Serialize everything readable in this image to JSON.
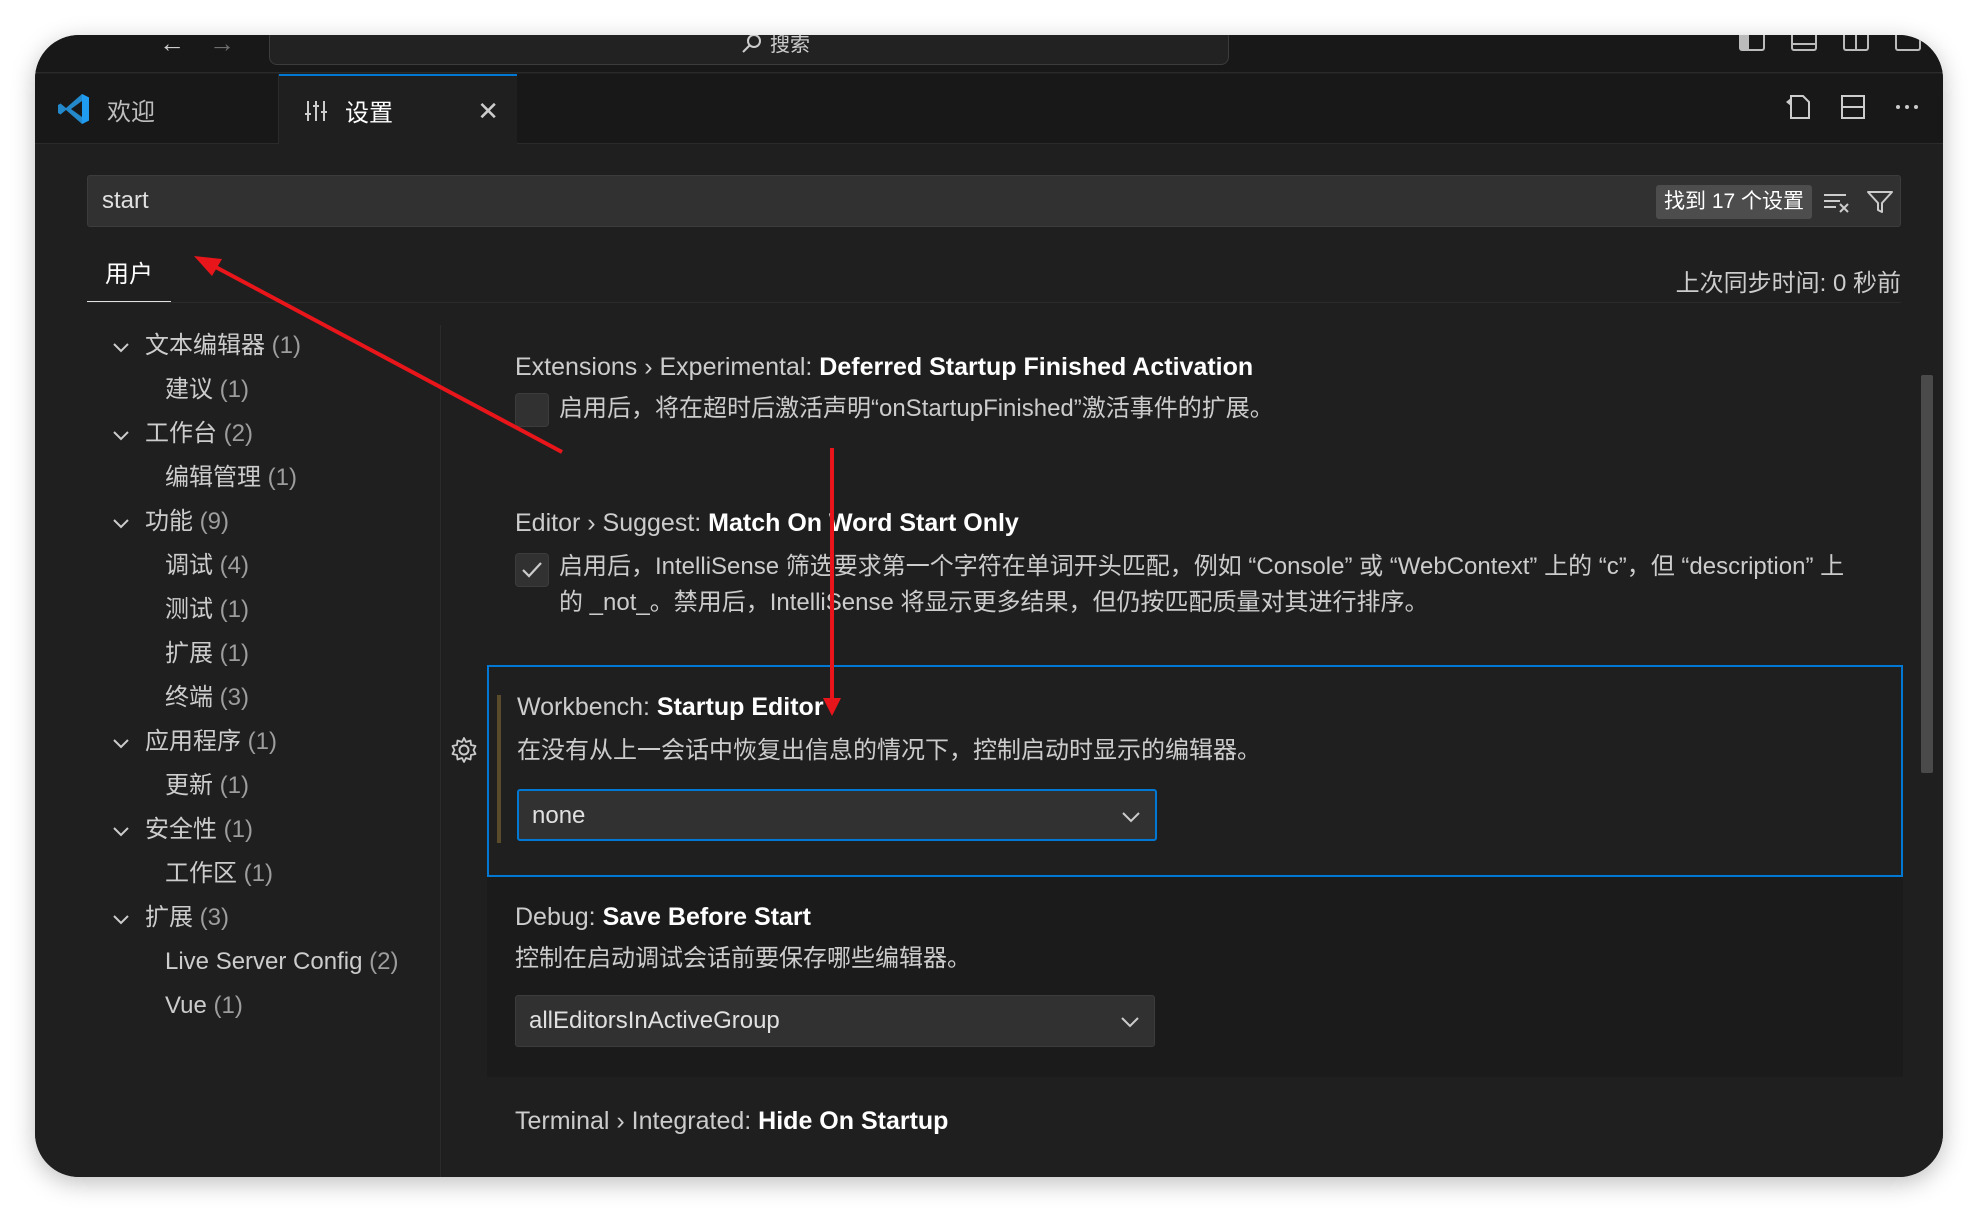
{
  "titlebar": {
    "command_center_placeholder": "搜索"
  },
  "tabs": [
    {
      "label": "欢迎"
    },
    {
      "label": "设置"
    }
  ],
  "search": {
    "value": "start",
    "result_count": "找到 17 个设置"
  },
  "scope": {
    "user_tab": "用户",
    "sync_status": "上次同步时间: 0 秒前"
  },
  "toc": [
    {
      "label": "文本编辑器",
      "count": "(1)",
      "level": 0
    },
    {
      "label": "建议",
      "count": "(1)",
      "level": 1
    },
    {
      "label": "工作台",
      "count": "(2)",
      "level": 0
    },
    {
      "label": "编辑管理",
      "count": "(1)",
      "level": 1
    },
    {
      "label": "功能",
      "count": "(9)",
      "level": 0
    },
    {
      "label": "调试",
      "count": "(4)",
      "level": 1
    },
    {
      "label": "测试",
      "count": "(1)",
      "level": 1
    },
    {
      "label": "扩展",
      "count": "(1)",
      "level": 1
    },
    {
      "label": "终端",
      "count": "(3)",
      "level": 1
    },
    {
      "label": "应用程序",
      "count": "(1)",
      "level": 0
    },
    {
      "label": "更新",
      "count": "(1)",
      "level": 1
    },
    {
      "label": "安全性",
      "count": "(1)",
      "level": 0
    },
    {
      "label": "工作区",
      "count": "(1)",
      "level": 1
    },
    {
      "label": "扩展",
      "count": "(3)",
      "level": 0
    },
    {
      "label": "Live Server Config",
      "count": "(2)",
      "level": 1
    },
    {
      "label": "Vue",
      "count": "(1)",
      "level": 1
    }
  ],
  "settings": [
    {
      "category": "Extensions › Experimental: ",
      "name": "Deferred Startup Finished Activation",
      "type": "checkbox",
      "checked": false,
      "description": "启用后，将在超时后激活声明“onStartupFinished”激活事件的扩展。"
    },
    {
      "category": "Editor › Suggest: ",
      "name": "Match On Word Start Only",
      "type": "checkbox",
      "checked": true,
      "description": "启用后，IntelliSense 筛选要求第一个字符在单词开头匹配，例如 “Console” 或 “WebContext” 上的 “c”，但 “description” 上的 _not_。禁用后，IntelliSense 将显示更多结果，但仍按匹配质量对其进行排序。"
    },
    {
      "category": "Workbench: ",
      "name": "Startup Editor",
      "type": "select",
      "description": "在没有从上一会话中恢复出信息的情况下，控制启动时显示的编辑器。",
      "value": "none"
    },
    {
      "category": "Debug: ",
      "name": "Save Before Start",
      "type": "select",
      "description": "控制在启动调试会话前要保存哪些编辑器。",
      "value": "allEditorsInActiveGroup"
    },
    {
      "category": "Terminal › Integrated: ",
      "name": "Hide On Startup"
    }
  ],
  "colors": {
    "accent": "#0078d4",
    "annotation": "#e8161b",
    "background": "#1f1f1f"
  }
}
